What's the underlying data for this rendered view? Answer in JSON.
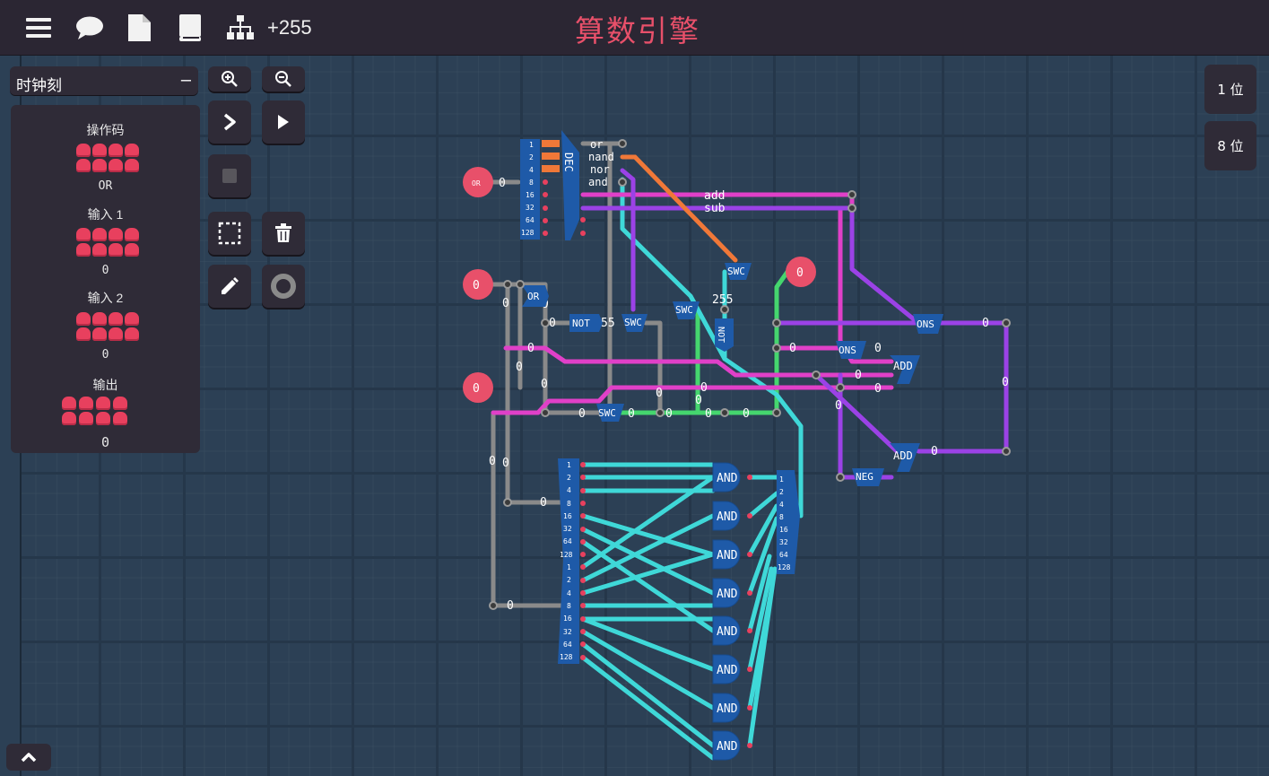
{
  "header": {
    "title": "算数引擎",
    "component_count": "+255",
    "icons": [
      "menu-icon",
      "chat-icon",
      "document-icon",
      "book-icon",
      "hierarchy-icon"
    ]
  },
  "left_panel": {
    "tick_label": "时钟刻",
    "tick_collapse": "–",
    "opcode_label": "操作码",
    "opcode_value": "OR",
    "input1_label": "输入 1",
    "input1_value": "0",
    "input2_label": "输入 2",
    "input2_value": "0",
    "output_label": "输出",
    "output_value": "0"
  },
  "tools": [
    "zoom-in-icon",
    "zoom-out-icon",
    "step-icon",
    "run-icon",
    "stop-icon",
    "select-icon",
    "delete-icon",
    "pencil-icon",
    "circle-icon"
  ],
  "bit_width": {
    "option_1": "1 位",
    "option_8": "8 位"
  },
  "circuit": {
    "opcode_input": "OR",
    "opcode_zero": "0",
    "decoder_label": "DEC",
    "decoder_pins": [
      "1",
      "2",
      "4",
      "8",
      "16",
      "32",
      "64",
      "128"
    ],
    "decoder_outputs": [
      "or",
      "nand",
      "nor",
      "and"
    ],
    "bus_labels": [
      "add",
      "sub"
    ],
    "gates": {
      "or": "OR",
      "not": "NOT",
      "switch": "SWC",
      "add": "ADD",
      "neg": "NEG",
      "ons": "ONS",
      "and": "AND",
      "not_vertical": "NOT"
    },
    "constant_255": "255",
    "const_55": "55",
    "input_zero": "0",
    "wire_zero": "0",
    "split_pins": [
      "1",
      "2",
      "4",
      "8",
      "16",
      "32",
      "64",
      "128"
    ]
  },
  "colors": {
    "accent": "#e8506a",
    "wire_pink": "#e040c8",
    "wire_purple": "#9b42e6",
    "wire_cyan": "#3fd8d8",
    "wire_green": "#45d66e",
    "wire_orange": "#f07838",
    "wire_gray": "#8a8a8a",
    "pin_red": "#e8405e",
    "component_blue": "#1e5aa8"
  }
}
